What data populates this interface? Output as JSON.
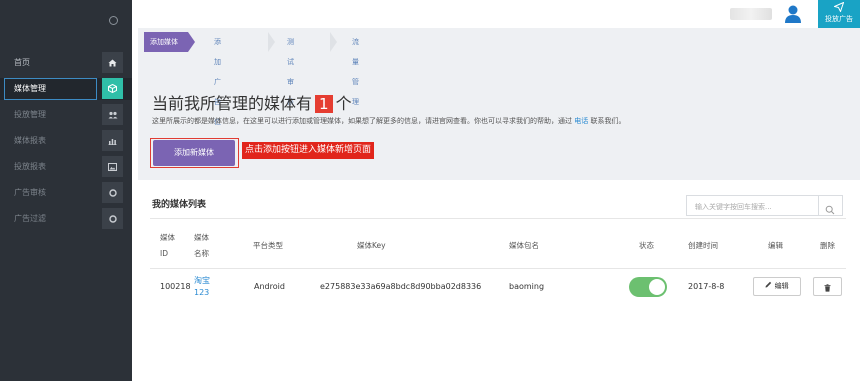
{
  "sidebar": {
    "items": [
      {
        "label": "首页",
        "icon": "home-icon"
      },
      {
        "label": "媒体管理",
        "icon": "cube-icon"
      },
      {
        "label": "投放管理",
        "icon": "users-icon"
      },
      {
        "label": "媒体报表",
        "icon": "bar-chart-icon"
      },
      {
        "label": "投放报表",
        "icon": "picture-icon"
      },
      {
        "label": "广告审核",
        "icon": "circle-icon"
      },
      {
        "label": "广告过滤",
        "icon": "circle-icon"
      }
    ]
  },
  "header": {
    "launch_button": "投放广告"
  },
  "steps": [
    "添加媒体",
    "添加广告位",
    "测试审核",
    "流量管理"
  ],
  "headline": {
    "prefix": "当前我所管理的媒体有",
    "count": "1",
    "suffix": "个"
  },
  "intro": {
    "text": "这里所展示的都是媒体信息，在这里可以进行添加或管理媒体，如果想了解更多的信息，请进官网查看。你也可以寻求我们的帮助，通过",
    "link": "电话",
    "after": "联系我们。"
  },
  "add_button": "添加新媒体",
  "annotation": "点击添加按钮进入媒体新增页面",
  "table": {
    "title": "我的媒体列表",
    "search_placeholder": "输入关键字按回车搜索...",
    "headers": {
      "media_id_1": "媒体",
      "media_id_2": "ID",
      "media_name_1": "媒体",
      "media_name_2": "名称",
      "platform": "平台类型",
      "key": "媒体Key",
      "package": "媒体包名",
      "status": "状态",
      "created": "创建时间",
      "edit": "编辑",
      "delete": "删除"
    },
    "rows": [
      {
        "id": "100218",
        "name_1": "淘宝",
        "name_2": "123",
        "platform": "Android",
        "key": "e275883e33a69a8bdc8d90bba02d8336",
        "package": "baoming",
        "status": "on",
        "created": "2017-8-8",
        "edit_label": "编辑"
      }
    ]
  },
  "colors": {
    "sidebar_bg": "#2c3138",
    "accent_purple": "#7b64b3",
    "active_icon": "#2fbfa8",
    "launch_button": "#19a3c5",
    "highlight_red": "#e1251b",
    "toggle_on": "#6cc070",
    "link_blue": "#2a8ad2"
  }
}
